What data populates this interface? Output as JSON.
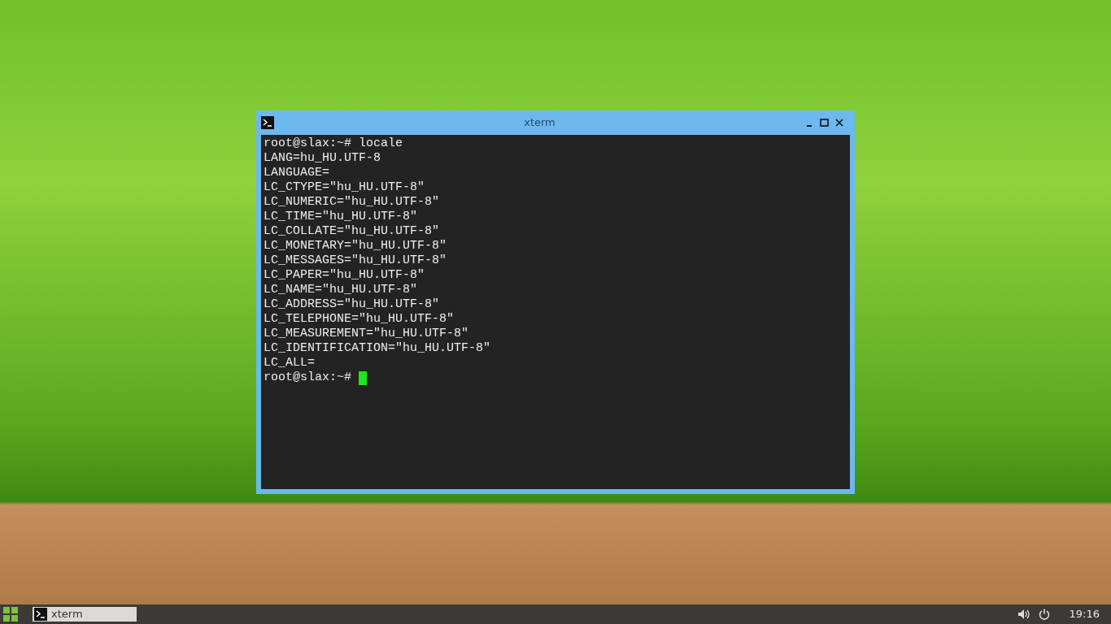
{
  "window": {
    "title": "xterm"
  },
  "terminal": {
    "lines": [
      "root@slax:~# locale",
      "LANG=hu_HU.UTF-8",
      "LANGUAGE=",
      "LC_CTYPE=\"hu_HU.UTF-8\"",
      "LC_NUMERIC=\"hu_HU.UTF-8\"",
      "LC_TIME=\"hu_HU.UTF-8\"",
      "LC_COLLATE=\"hu_HU.UTF-8\"",
      "LC_MONETARY=\"hu_HU.UTF-8\"",
      "LC_MESSAGES=\"hu_HU.UTF-8\"",
      "LC_PAPER=\"hu_HU.UTF-8\"",
      "LC_NAME=\"hu_HU.UTF-8\"",
      "LC_ADDRESS=\"hu_HU.UTF-8\"",
      "LC_TELEPHONE=\"hu_HU.UTF-8\"",
      "LC_MEASUREMENT=\"hu_HU.UTF-8\"",
      "LC_IDENTIFICATION=\"hu_HU.UTF-8\"",
      "LC_ALL="
    ],
    "prompt": "root@slax:~#"
  },
  "taskbar": {
    "tasks": [
      {
        "label": "xterm",
        "selected": true
      }
    ],
    "clock": "19:16"
  }
}
